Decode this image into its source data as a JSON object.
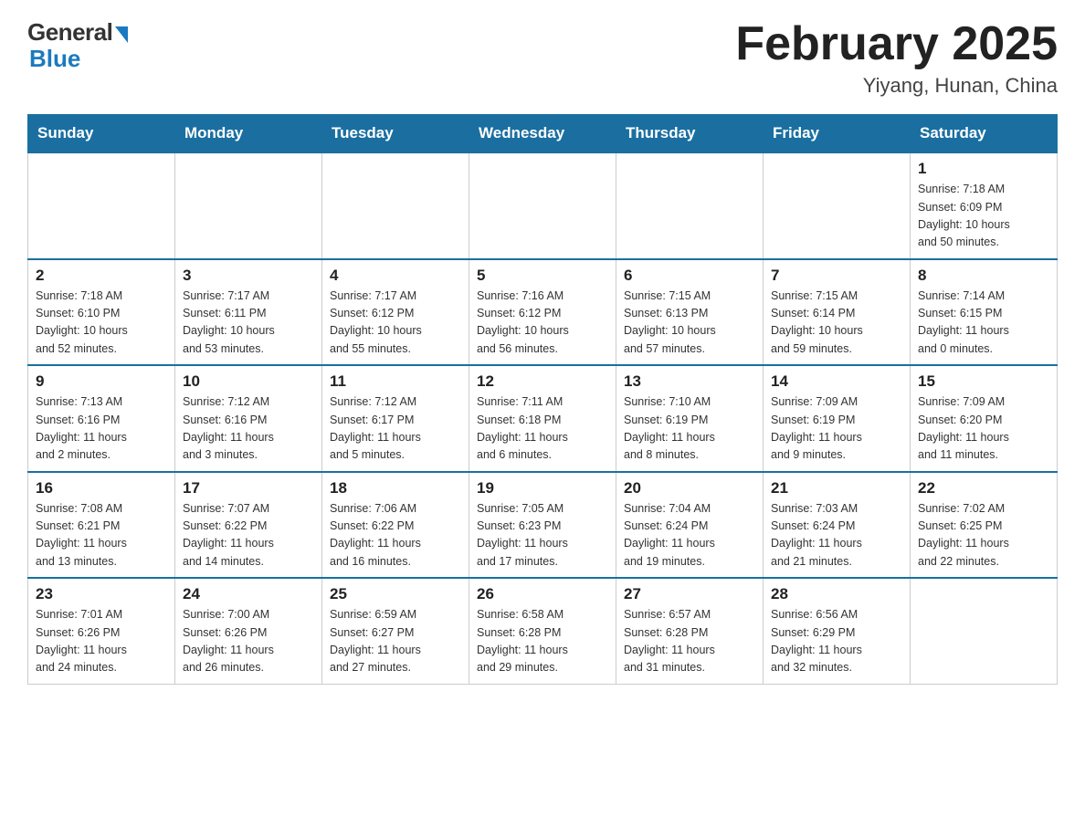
{
  "header": {
    "logo_general": "General",
    "logo_blue": "Blue",
    "month_title": "February 2025",
    "location": "Yiyang, Hunan, China"
  },
  "weekdays": [
    "Sunday",
    "Monday",
    "Tuesday",
    "Wednesday",
    "Thursday",
    "Friday",
    "Saturday"
  ],
  "weeks": [
    [
      {
        "day": "",
        "info": ""
      },
      {
        "day": "",
        "info": ""
      },
      {
        "day": "",
        "info": ""
      },
      {
        "day": "",
        "info": ""
      },
      {
        "day": "",
        "info": ""
      },
      {
        "day": "",
        "info": ""
      },
      {
        "day": "1",
        "info": "Sunrise: 7:18 AM\nSunset: 6:09 PM\nDaylight: 10 hours\nand 50 minutes."
      }
    ],
    [
      {
        "day": "2",
        "info": "Sunrise: 7:18 AM\nSunset: 6:10 PM\nDaylight: 10 hours\nand 52 minutes."
      },
      {
        "day": "3",
        "info": "Sunrise: 7:17 AM\nSunset: 6:11 PM\nDaylight: 10 hours\nand 53 minutes."
      },
      {
        "day": "4",
        "info": "Sunrise: 7:17 AM\nSunset: 6:12 PM\nDaylight: 10 hours\nand 55 minutes."
      },
      {
        "day": "5",
        "info": "Sunrise: 7:16 AM\nSunset: 6:12 PM\nDaylight: 10 hours\nand 56 minutes."
      },
      {
        "day": "6",
        "info": "Sunrise: 7:15 AM\nSunset: 6:13 PM\nDaylight: 10 hours\nand 57 minutes."
      },
      {
        "day": "7",
        "info": "Sunrise: 7:15 AM\nSunset: 6:14 PM\nDaylight: 10 hours\nand 59 minutes."
      },
      {
        "day": "8",
        "info": "Sunrise: 7:14 AM\nSunset: 6:15 PM\nDaylight: 11 hours\nand 0 minutes."
      }
    ],
    [
      {
        "day": "9",
        "info": "Sunrise: 7:13 AM\nSunset: 6:16 PM\nDaylight: 11 hours\nand 2 minutes."
      },
      {
        "day": "10",
        "info": "Sunrise: 7:12 AM\nSunset: 6:16 PM\nDaylight: 11 hours\nand 3 minutes."
      },
      {
        "day": "11",
        "info": "Sunrise: 7:12 AM\nSunset: 6:17 PM\nDaylight: 11 hours\nand 5 minutes."
      },
      {
        "day": "12",
        "info": "Sunrise: 7:11 AM\nSunset: 6:18 PM\nDaylight: 11 hours\nand 6 minutes."
      },
      {
        "day": "13",
        "info": "Sunrise: 7:10 AM\nSunset: 6:19 PM\nDaylight: 11 hours\nand 8 minutes."
      },
      {
        "day": "14",
        "info": "Sunrise: 7:09 AM\nSunset: 6:19 PM\nDaylight: 11 hours\nand 9 minutes."
      },
      {
        "day": "15",
        "info": "Sunrise: 7:09 AM\nSunset: 6:20 PM\nDaylight: 11 hours\nand 11 minutes."
      }
    ],
    [
      {
        "day": "16",
        "info": "Sunrise: 7:08 AM\nSunset: 6:21 PM\nDaylight: 11 hours\nand 13 minutes."
      },
      {
        "day": "17",
        "info": "Sunrise: 7:07 AM\nSunset: 6:22 PM\nDaylight: 11 hours\nand 14 minutes."
      },
      {
        "day": "18",
        "info": "Sunrise: 7:06 AM\nSunset: 6:22 PM\nDaylight: 11 hours\nand 16 minutes."
      },
      {
        "day": "19",
        "info": "Sunrise: 7:05 AM\nSunset: 6:23 PM\nDaylight: 11 hours\nand 17 minutes."
      },
      {
        "day": "20",
        "info": "Sunrise: 7:04 AM\nSunset: 6:24 PM\nDaylight: 11 hours\nand 19 minutes."
      },
      {
        "day": "21",
        "info": "Sunrise: 7:03 AM\nSunset: 6:24 PM\nDaylight: 11 hours\nand 21 minutes."
      },
      {
        "day": "22",
        "info": "Sunrise: 7:02 AM\nSunset: 6:25 PM\nDaylight: 11 hours\nand 22 minutes."
      }
    ],
    [
      {
        "day": "23",
        "info": "Sunrise: 7:01 AM\nSunset: 6:26 PM\nDaylight: 11 hours\nand 24 minutes."
      },
      {
        "day": "24",
        "info": "Sunrise: 7:00 AM\nSunset: 6:26 PM\nDaylight: 11 hours\nand 26 minutes."
      },
      {
        "day": "25",
        "info": "Sunrise: 6:59 AM\nSunset: 6:27 PM\nDaylight: 11 hours\nand 27 minutes."
      },
      {
        "day": "26",
        "info": "Sunrise: 6:58 AM\nSunset: 6:28 PM\nDaylight: 11 hours\nand 29 minutes."
      },
      {
        "day": "27",
        "info": "Sunrise: 6:57 AM\nSunset: 6:28 PM\nDaylight: 11 hours\nand 31 minutes."
      },
      {
        "day": "28",
        "info": "Sunrise: 6:56 AM\nSunset: 6:29 PM\nDaylight: 11 hours\nand 32 minutes."
      },
      {
        "day": "",
        "info": ""
      }
    ]
  ]
}
